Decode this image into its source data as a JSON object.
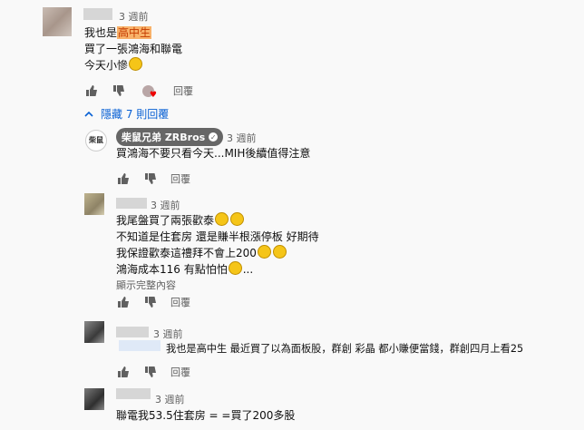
{
  "comments": [
    {
      "time": "3 週前",
      "lines": [
        "我也是",
        "買了一張鴻海和聯電",
        "今天小慘"
      ],
      "highlight": "高中生"
    },
    {
      "time": "3 週前",
      "author": "柴鼠兄弟 ZRBros",
      "lines": [
        "買鴻海不要只看今天...MIH後續值得注意"
      ]
    },
    {
      "time": "3 週前",
      "lines": [
        "我尾盤買了兩張歡泰",
        "不知道是住套房 還是賺半根漲停板 好期待",
        "我保證歡泰這禮拜不會上200",
        "鴻海成本116 有點怕怕"
      ]
    },
    {
      "time": "3 週前",
      "lines": [
        "我也是高中生 最近買了以為面板股，群創 彩晶 都小賺便當錢，群創四月上看25"
      ]
    },
    {
      "time": "3 週前",
      "lines": [
        "聯電我53.5住套房 = =買了200多股"
      ]
    }
  ],
  "actions": {
    "reply_label": "回覆"
  },
  "hide_replies": "隱藏 7 則回覆",
  "show_full": "顯示完整內容",
  "avatar_text": "柴鼠",
  "colors": {
    "accent": "#065fd4",
    "highlight": "#f8b26a"
  }
}
